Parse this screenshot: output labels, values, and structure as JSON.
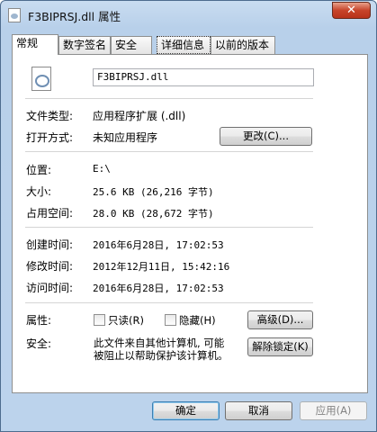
{
  "window": {
    "title": "F3BIPRSJ.dll 属性",
    "close_symbol": "✕"
  },
  "tabs": [
    "常规",
    "数字签名",
    "安全",
    "详细信息",
    "以前的版本"
  ],
  "general": {
    "file_name": "F3BIPRSJ.dll",
    "file_type_label": "文件类型:",
    "file_type_value": "应用程序扩展 (.dll)",
    "open_with_label": "打开方式:",
    "open_with_value": "未知应用程序",
    "change_button": "更改(C)...",
    "location_label": "位置:",
    "location_value": "E:\\",
    "size_label": "大小:",
    "size_value": "25.6 KB (26,216 字节)",
    "size_on_disk_label": "占用空间:",
    "size_on_disk_value": "28.0 KB (28,672 字节)",
    "created_label": "创建时间:",
    "created_value": "2016年6月28日, 17:02:53",
    "modified_label": "修改时间:",
    "modified_value": "2012年12月11日, 15:42:16",
    "accessed_label": "访问时间:",
    "accessed_value": "2016年6月28日, 17:02:53",
    "attributes_label": "属性:",
    "readonly_label": "只读(R)",
    "hidden_label": "隐藏(H)",
    "advanced_button": "高级(D)...",
    "security_label": "安全:",
    "security_line1": "此文件来自其他计算机, 可能",
    "security_line2": "被阻止以帮助保护该计算机。",
    "unblock_button": "解除锁定(K)"
  },
  "footer": {
    "ok": "确定",
    "cancel": "取消",
    "apply": "应用(A)"
  }
}
